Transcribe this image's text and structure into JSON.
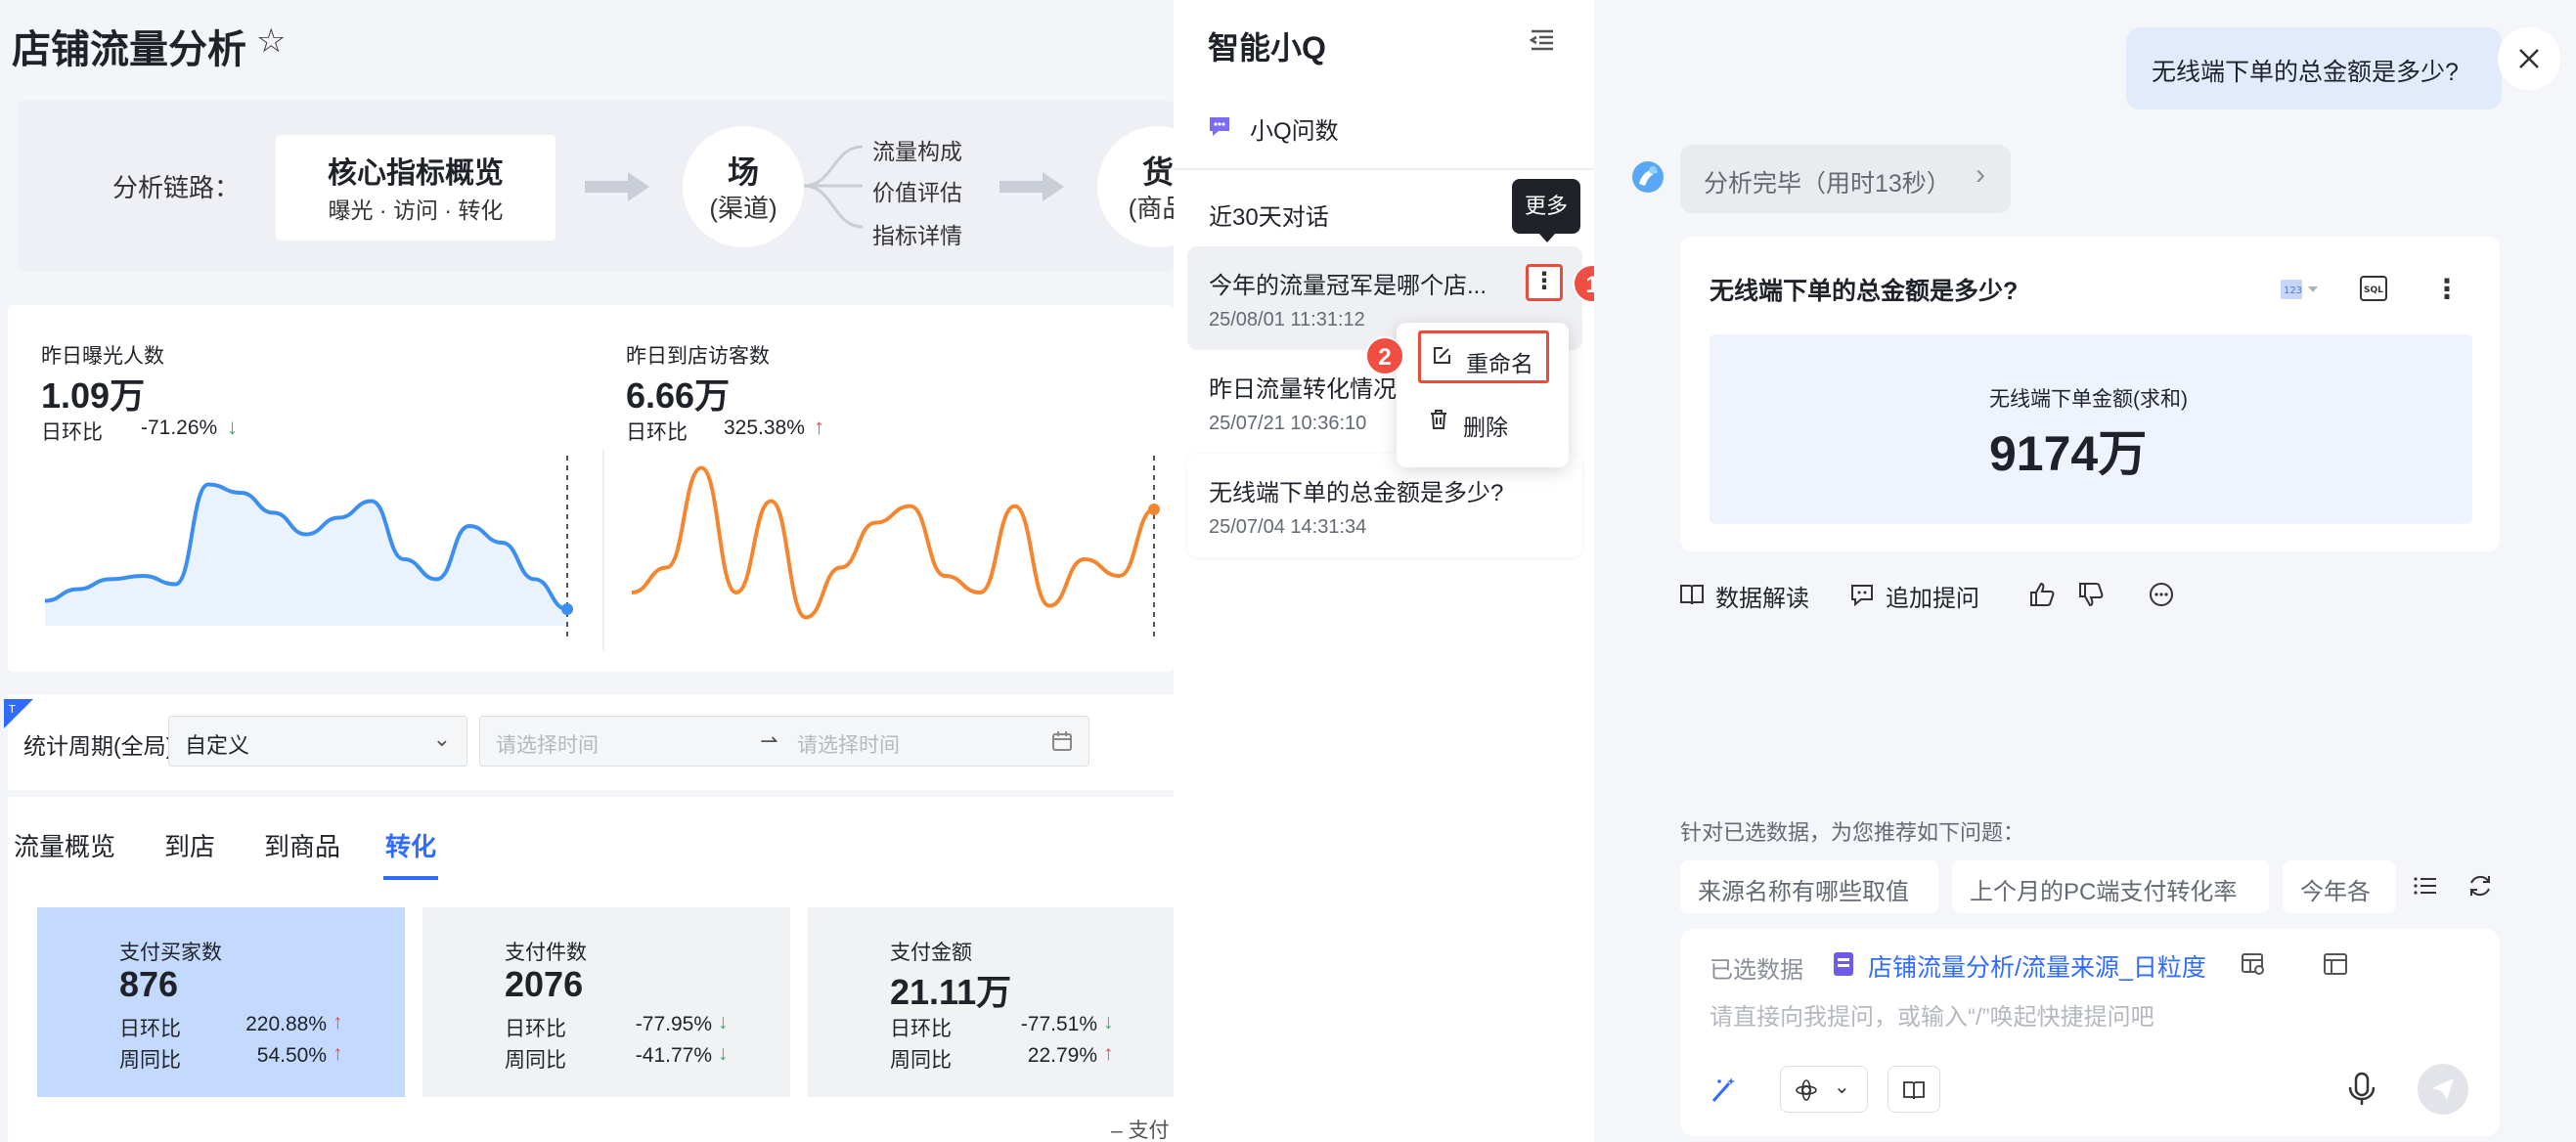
{
  "dashboard": {
    "title": "店铺流量分析",
    "chain": {
      "label": "分析链路：",
      "core_title": "核心指标概览",
      "core_sub": "曝光 · 访问 · 转化",
      "node1_main": "场",
      "node1_sub": "(渠道)",
      "branches": [
        "流量构成",
        "价值评估",
        "指标详情"
      ],
      "node2_main": "货",
      "node2_sub": "(商品"
    },
    "metrics": [
      {
        "label": "昨日曝光人数",
        "value": "1.09万",
        "ratio_label": "日环比",
        "ratio_value": "-71.26%",
        "trend": "down"
      },
      {
        "label": "昨日到店访客数",
        "value": "6.66万",
        "ratio_label": "日环比",
        "ratio_value": "325.38%",
        "trend": "up"
      }
    ],
    "filter": {
      "label": "统计周期(全局)",
      "select_value": "自定义",
      "start_placeholder": "请选择时间",
      "end_placeholder": "请选择时间"
    },
    "tabs": [
      "流量概览",
      "到店",
      "到商品",
      "转化"
    ],
    "active_tab": "转化",
    "kpis": [
      {
        "label": "支付买家数",
        "value": "876",
        "r1l": "日环比",
        "r1v": "220.88%",
        "r1t": "up",
        "r2l": "周同比",
        "r2v": "54.50%",
        "r2t": "up"
      },
      {
        "label": "支付件数",
        "value": "2076",
        "r1l": "日环比",
        "r1v": "-77.95%",
        "r1t": "down",
        "r2l": "周同比",
        "r2v": "-41.77%",
        "r2t": "down"
      },
      {
        "label": "支付金额",
        "value": "21.11万",
        "r1l": "日环比",
        "r1v": "-77.51%",
        "r1t": "down",
        "r2l": "周同比",
        "r2v": "22.79%",
        "r2t": "up"
      }
    ],
    "legend_stub": "支付"
  },
  "history": {
    "title": "智能小Q",
    "qask_label": "小Q问数",
    "section_title": "近30天对话",
    "conversations": [
      {
        "title": "今年的流量冠军是哪个店...",
        "time": "25/08/01 11:31:12"
      },
      {
        "title": "昨日流量转化情况",
        "time": "25/07/21 10:36:10"
      },
      {
        "title": "无线端下单的总金额是多少?",
        "time": "25/07/04 14:31:34"
      }
    ],
    "tooltip": "更多",
    "badge1": "1",
    "badge2": "2",
    "menu": {
      "rename": "重命名",
      "delete": "删除"
    }
  },
  "chat": {
    "user_question": "无线端下单的总金额是多少?",
    "status": "分析完毕（用时13秒）",
    "card": {
      "title": "无线端下单的总金额是多少?",
      "metric_label": "无线端下单金额(求和)",
      "metric_value": "9174万",
      "sql_label": "SQL"
    },
    "actions": {
      "interpret": "数据解读",
      "followup": "追加提问"
    },
    "rec_label": "针对已选数据，为您推荐如下问题：",
    "chips": [
      "来源名称有哪些取值",
      "上个月的PC端支付转化率",
      "今年各"
    ],
    "input": {
      "selected_label": "已选数据",
      "dataset": "店铺流量分析/流量来源_日粒度",
      "placeholder": "请直接向我提问，或输入“/”唤起快捷提问吧"
    }
  },
  "colors": {
    "accent": "#2f6bff",
    "up": "#f5474f",
    "down": "#28b463",
    "highlight_red": "#e74c3c",
    "chart_blue": "#3b8ff0",
    "chart_orange": "#f5862f"
  },
  "chart_data": [
    {
      "type": "line",
      "y": [
        0.15,
        0.22,
        0.28,
        0.3,
        0.25,
        0.85,
        0.8,
        0.68,
        0.55,
        0.65,
        0.75,
        0.4,
        0.28,
        0.6,
        0.5,
        0.28,
        0.1
      ]
    },
    {
      "type": "line",
      "y": [
        0.2,
        0.35,
        0.95,
        0.2,
        0.75,
        0.05,
        0.35,
        0.62,
        0.72,
        0.3,
        0.2,
        0.72,
        0.12,
        0.4,
        0.3,
        0.7
      ]
    }
  ]
}
